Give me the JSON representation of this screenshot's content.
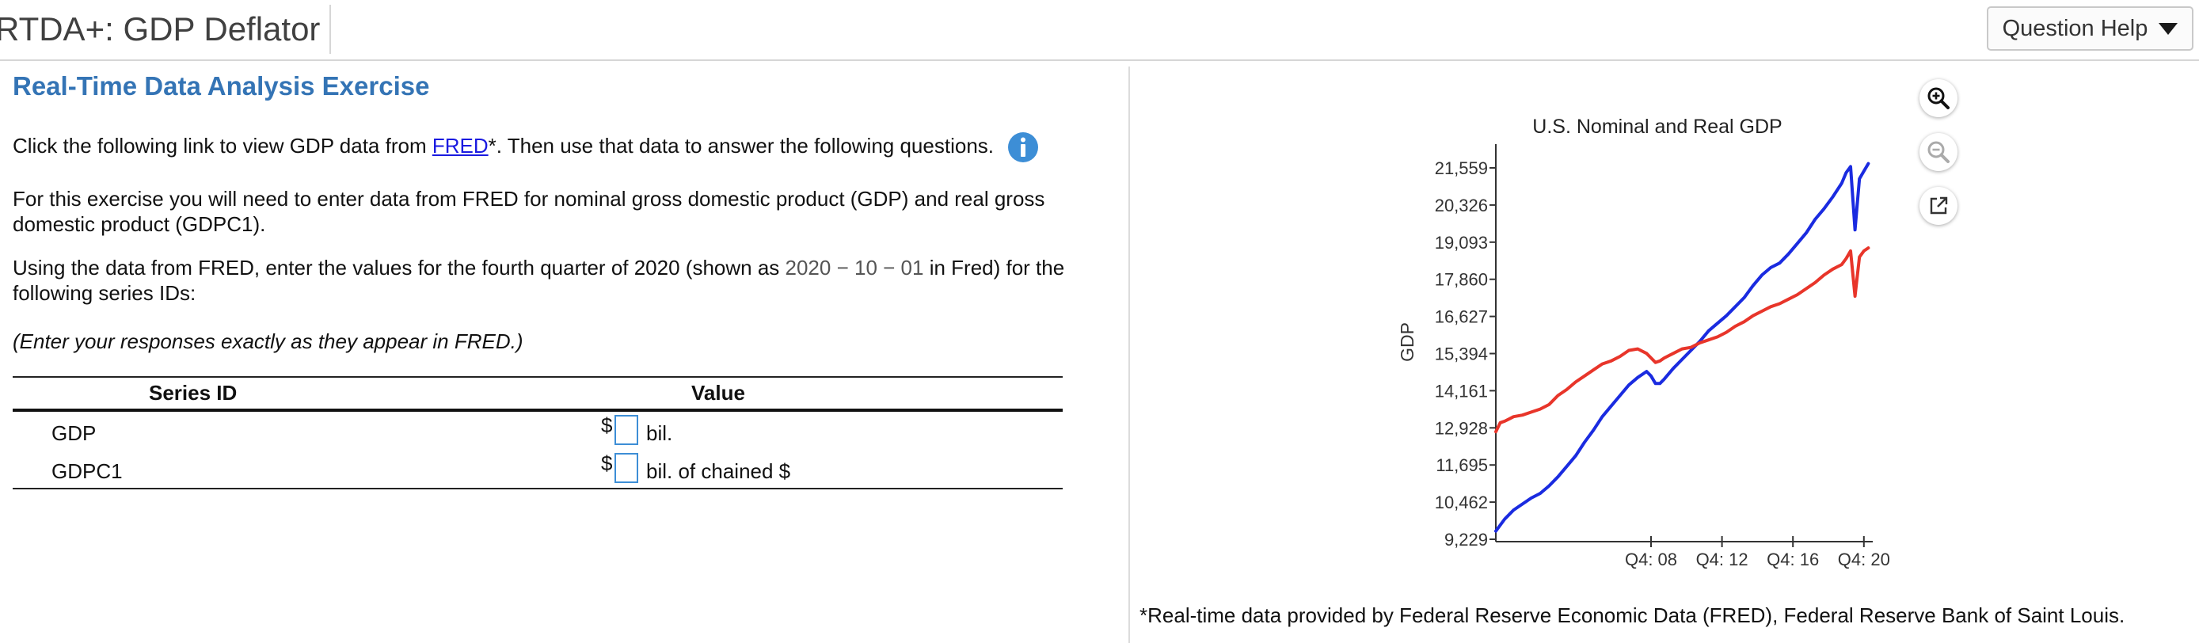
{
  "header": {
    "app_title": "RTDA+: GDP Deflator",
    "help_label": "Question Help"
  },
  "exercise": {
    "title": "Real-Time Data Analysis Exercise",
    "intro_before_link": "Click the following link to view GDP data from ",
    "link_text": "FRED",
    "intro_after_link": "*. Then use that data to answer the following questions.",
    "paragraph2": "For this exercise you will need to enter data from FRED for nominal gross domestic product (GDP) and real gross domestic product (GDPC1).",
    "paragraph3_before": "Using the data from FRED, enter the values for the fourth quarter of 2020 (shown as ",
    "paragraph3_date": "2020 − 10 − 01",
    "paragraph3_after": " in Fred) for the following series IDs:",
    "instruction": "(Enter your responses exactly as they appear in FRED.)",
    "table": {
      "headers": [
        "Series ID",
        "Value"
      ],
      "rows": [
        {
          "series_id": "GDP",
          "currency": "$",
          "value": "",
          "unit": "bil."
        },
        {
          "series_id": "GDPC1",
          "currency": "$",
          "value": "",
          "unit": "bil. of chained $"
        }
      ]
    }
  },
  "chart_tools": [
    "zoom-in-icon",
    "zoom-out-icon",
    "popout-icon"
  ],
  "chart_data": {
    "type": "line",
    "title": "U.S. Nominal and Real GDP",
    "ylabel": "GDP",
    "xlabel": "",
    "ylim": [
      9229,
      22300
    ],
    "yticks": [
      "9,229",
      "10,462",
      "11,695",
      "12,928",
      "14,161",
      "15,394",
      "16,627",
      "17,860",
      "19,093",
      "20,326",
      "21,559"
    ],
    "ytick_values": [
      9229,
      10462,
      11695,
      12928,
      14161,
      15394,
      16627,
      17860,
      19093,
      20326,
      21559
    ],
    "xticks": [
      "Q4: 08",
      "Q4: 12",
      "Q4: 16",
      "Q4: 20"
    ],
    "xtick_positions": [
      2008.75,
      2012.75,
      2016.75,
      2020.75
    ],
    "xlim": [
      2000.0,
      2021.25
    ],
    "grid": false,
    "series": [
      {
        "color": "#1a2be0",
        "x": [
          2000.0,
          2000.5,
          2001.0,
          2001.5,
          2002.0,
          2002.5,
          2003.0,
          2003.5,
          2004.0,
          2004.5,
          2005.0,
          2005.5,
          2006.0,
          2006.5,
          2007.0,
          2007.5,
          2008.0,
          2008.5,
          2008.75,
          2009.0,
          2009.25,
          2009.5,
          2010.0,
          2010.5,
          2011.0,
          2011.5,
          2012.0,
          2012.5,
          2013.0,
          2013.5,
          2014.0,
          2014.5,
          2015.0,
          2015.5,
          2016.0,
          2016.5,
          2017.0,
          2017.5,
          2018.0,
          2018.5,
          2019.0,
          2019.5,
          2019.75,
          2020.0,
          2020.25,
          2020.5,
          2020.75,
          2021.0
        ],
        "values": [
          9500,
          9900,
          10200,
          10400,
          10600,
          10750,
          11000,
          11300,
          11650,
          12000,
          12450,
          12850,
          13300,
          13650,
          14000,
          14350,
          14600,
          14800,
          14650,
          14400,
          14400,
          14550,
          14900,
          15200,
          15500,
          15800,
          16150,
          16400,
          16650,
          16950,
          17250,
          17650,
          18000,
          18250,
          18400,
          18700,
          19050,
          19400,
          19850,
          20200,
          20600,
          21050,
          21400,
          21600,
          19500,
          21200,
          21450,
          21700
        ]
      },
      {
        "color": "#e8352a",
        "x": [
          2000.0,
          2000.25,
          2000.5,
          2001.0,
          2001.5,
          2002.0,
          2002.5,
          2003.0,
          2003.5,
          2004.0,
          2004.5,
          2005.0,
          2005.5,
          2006.0,
          2006.5,
          2007.0,
          2007.5,
          2008.0,
          2008.5,
          2008.75,
          2009.0,
          2009.25,
          2009.5,
          2010.0,
          2010.5,
          2011.0,
          2011.5,
          2012.0,
          2012.5,
          2013.0,
          2013.5,
          2014.0,
          2014.5,
          2015.0,
          2015.5,
          2016.0,
          2016.5,
          2017.0,
          2017.5,
          2018.0,
          2018.5,
          2019.0,
          2019.5,
          2019.75,
          2020.0,
          2020.25,
          2020.5,
          2020.75,
          2021.0
        ],
        "values": [
          12800,
          13100,
          13150,
          13300,
          13350,
          13450,
          13550,
          13700,
          14000,
          14200,
          14450,
          14650,
          14850,
          15050,
          15150,
          15300,
          15500,
          15550,
          15400,
          15250,
          15100,
          15150,
          15250,
          15400,
          15550,
          15600,
          15750,
          15850,
          15950,
          16100,
          16300,
          16450,
          16650,
          16800,
          16950,
          17050,
          17200,
          17350,
          17550,
          17750,
          18000,
          18200,
          18350,
          18550,
          18800,
          17300,
          18600,
          18800,
          18900
        ]
      }
    ]
  },
  "footnote": "*Real-time data provided by Federal Reserve Economic Data (FRED), Federal Reserve Bank of Saint Louis."
}
